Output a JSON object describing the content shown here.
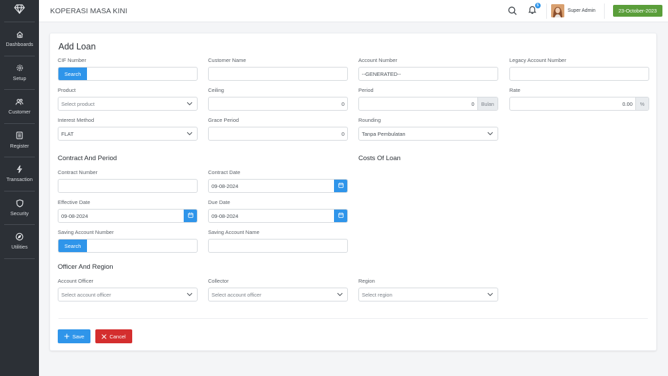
{
  "app": {
    "title": "KOPERASI MASA KINI",
    "notifications_count": "5",
    "user_name": "Super Admin",
    "date": "23-October-2023"
  },
  "sidebar": {
    "items": [
      {
        "label": "Dashboards",
        "icon": "home-icon"
      },
      {
        "label": "Setup",
        "icon": "gear-icon"
      },
      {
        "label": "Customer",
        "icon": "users-icon"
      },
      {
        "label": "Register",
        "icon": "book-icon"
      },
      {
        "label": "Transaction",
        "icon": "lightning-icon"
      },
      {
        "label": "Security",
        "icon": "shield-icon"
      },
      {
        "label": "Utilities",
        "icon": "compass-icon"
      }
    ]
  },
  "form": {
    "title": "Add Loan",
    "search_label": "Search",
    "fields": {
      "cif_number": {
        "label": "CIF Number",
        "value": ""
      },
      "customer_name": {
        "label": "Customer Name",
        "value": ""
      },
      "account_number": {
        "label": "Account Number",
        "value": "--GENERATED--"
      },
      "legacy_account_number": {
        "label": "Legacy Account Number",
        "value": ""
      },
      "product": {
        "label": "Product",
        "placeholder": "Select product"
      },
      "ceiling": {
        "label": "Ceiling",
        "value": "0"
      },
      "period": {
        "label": "Period",
        "value": "0",
        "unit": "Bulan"
      },
      "rate": {
        "label": "Rate",
        "value": "0.00",
        "unit": "%"
      },
      "interest_method": {
        "label": "Interest Method",
        "value": "FLAT"
      },
      "grace_period": {
        "label": "Grace Period",
        "value": "0"
      },
      "rounding": {
        "label": "Rounding",
        "value": "Tanpa Pembulatan"
      }
    },
    "contract_section": {
      "title": "Contract And Period",
      "contract_number": {
        "label": "Contract Number",
        "value": ""
      },
      "contract_date": {
        "label": "Contract Date",
        "value": "09-08-2024"
      },
      "effective_date": {
        "label": "Effective Date",
        "value": "09-08-2024"
      },
      "due_date": {
        "label": "Due Date",
        "value": "09-08-2024"
      },
      "saving_account_number": {
        "label": "Saving Account Number",
        "value": ""
      },
      "saving_account_name": {
        "label": "Saving Account Name",
        "value": ""
      }
    },
    "costs_section": {
      "title": "Costs Of Loan"
    },
    "officer_section": {
      "title": "Officer And Region",
      "account_officer": {
        "label": "Account Officer",
        "placeholder": "Select account officer"
      },
      "collector": {
        "label": "Collector",
        "placeholder": "Select account officer"
      },
      "region": {
        "label": "Region",
        "placeholder": "Select region"
      }
    },
    "actions": {
      "save": "Save",
      "cancel": "Cancel"
    }
  },
  "colors": {
    "primary": "#2f95ea",
    "danger": "#d42e2e",
    "success": "#5a9e3a",
    "sidebar_bg": "#2c3036"
  }
}
